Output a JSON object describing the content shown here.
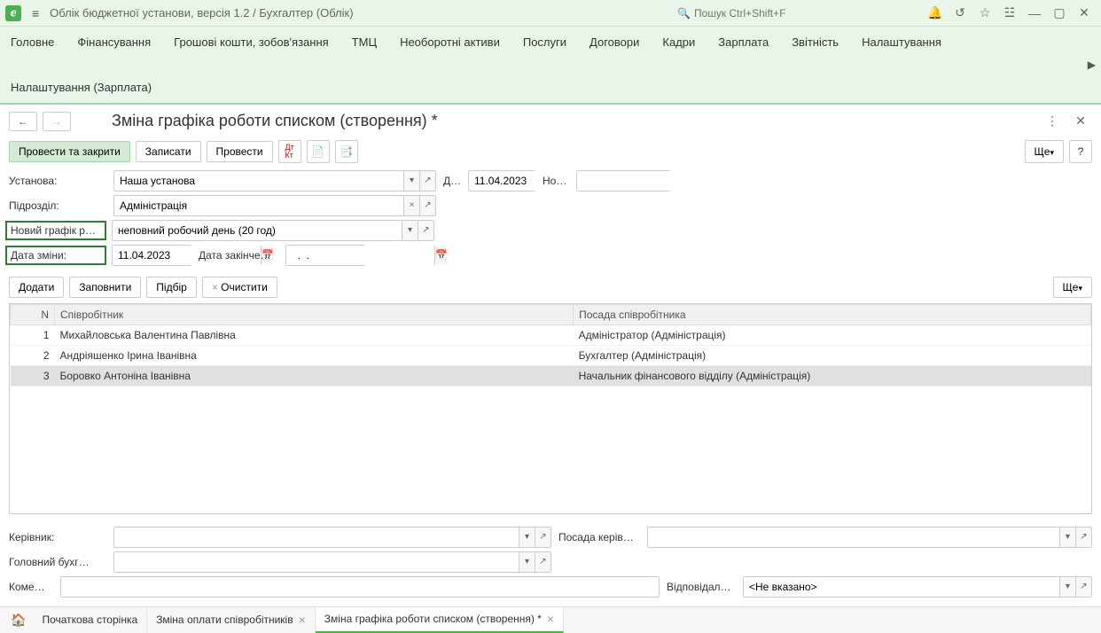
{
  "titlebar": {
    "app_title": "Облік бюджетної установи, версія 1.2 / Бухгалтер  (Облік)",
    "search_placeholder": "Пошук Ctrl+Shift+F"
  },
  "menu": {
    "items": [
      "Головне",
      "Фінансування",
      "Грошові кошти, зобов'язання",
      "ТМЦ",
      "Необоротні активи",
      "Послуги",
      "Договори",
      "Кадри",
      "Зарплата",
      "Звітність",
      "Налаштування",
      "Налаштування (Зарплата)"
    ]
  },
  "page": {
    "title": "Зміна графіка роботи списком (створення) *"
  },
  "toolbar": {
    "post_close": "Провести та закрити",
    "save": "Записати",
    "post": "Провести",
    "more": "Ще"
  },
  "form": {
    "org_label": "Установа:",
    "org_value": "Наша установа",
    "date_label": "Д…",
    "date_value": "11.04.2023",
    "num_label": "Но…",
    "num_value": "",
    "dept_label": "Підрозділ:",
    "dept_value": "Адміністрація",
    "newsched_label": "Новий графік ро…",
    "newsched_value": "неповний робочий день (20 год)",
    "changedate_label": "Дата зміни:",
    "changedate_value": "11.04.2023",
    "enddate_label": "Дата закінче…",
    "enddate_value": "  .  .    "
  },
  "table_toolbar": {
    "add": "Додати",
    "fill": "Заповнити",
    "select": "Підбір",
    "clear": "Очистити",
    "more": "Ще"
  },
  "table": {
    "col_n": "N",
    "col_emp": "Співробітник",
    "col_pos": "Посада співробітника",
    "rows": [
      {
        "n": "1",
        "emp": "Михайловська Валентина Павлівна",
        "pos": "Адміністратор (Адміністрація)"
      },
      {
        "n": "2",
        "emp": "Андріяшенко Ірина Іванівна",
        "pos": "Бухгалтер (Адміністрація)"
      },
      {
        "n": "3",
        "emp": "Боровко Антоніна Іванівна",
        "pos": "Начальник фінансового відділу (Адміністрація)"
      }
    ]
  },
  "bottom": {
    "head_label": "Керівник:",
    "head_pos_label": "Посада керів…",
    "acct_label": "Головний бухг…",
    "comment_label": "Коме…",
    "resp_label": "Відповідал…",
    "resp_value": "<Не вказано>"
  },
  "tabs": {
    "home": "Початкова сторінка",
    "t1": "Зміна оплати співробітників",
    "t2": "Зміна графіка роботи списком (створення) *"
  }
}
